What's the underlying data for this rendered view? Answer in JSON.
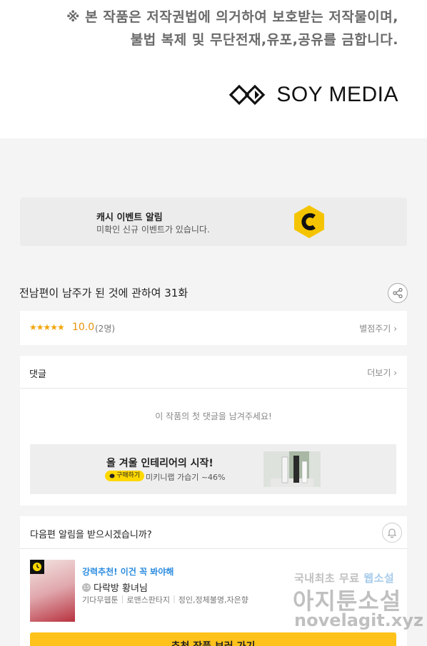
{
  "notice": {
    "line1": "※ 본 작품은 저작권법에 의거하여 보호받는 저작물이며,",
    "line2": "불법 복제 및 무단전재,유포,공유를 금합니다."
  },
  "brand": {
    "name": "SOY MEDIA",
    "icon": "soy-media-logo"
  },
  "cash_event": {
    "title": "캐시 이벤트 알림",
    "subtitle": "미확인 신규 이벤트가 있습니다.",
    "icon": "cash-c-logo",
    "accent": "#f5c400"
  },
  "episode": {
    "title": "전남편이 남주가 된 것에 관하여 31화",
    "share_icon": "share-icon"
  },
  "rating": {
    "stars": "★★★★★",
    "score": "10.0",
    "count": "(2명)",
    "rate_label": "별점주기",
    "star_color": "#f2a60d"
  },
  "comments": {
    "title": "댓글",
    "more_label": "더보기",
    "empty_message": "이 작품의 첫 댓글을 남겨주세요!"
  },
  "ad": {
    "title": "올 겨울 인테리어의 시작!",
    "pill": "구매하기",
    "description": "미키니랩 가습기 ~46%"
  },
  "next_notice": {
    "title": "다음편 알림을 받으시겠습니까?",
    "bell_icon": "bell-icon",
    "recommend_label": "강력추천! 이건 꼭 봐야해",
    "age_badge": "15",
    "work_title": "다락방 황녀님",
    "tags": [
      "기다무웹툰",
      "로맨스판타지",
      "정인,정체불명,자은향"
    ],
    "cta": "추천 작품 보러 가기",
    "cta_color": "#ffc21a"
  },
  "watermark": {
    "line1_prefix": "국내최초 무료",
    "line1_highlight": "웹소설",
    "line2": "아지툰소설",
    "line3": "novelagit.xyz"
  }
}
